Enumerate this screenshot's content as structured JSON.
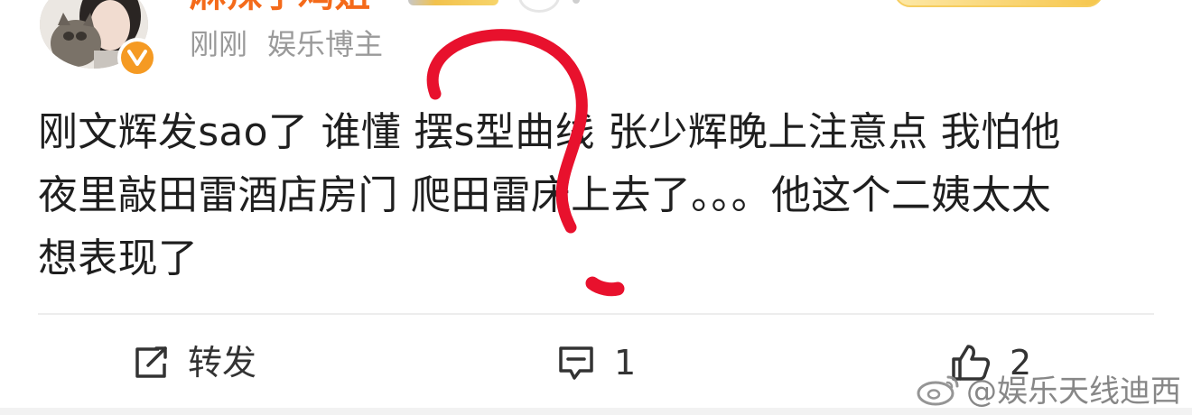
{
  "post": {
    "author": "麻辣子鸡姐",
    "time": "刚刚",
    "tag": "娱乐博主",
    "verified_color": "#f59a23",
    "text_lines": [
      "刚文辉发sao了 谁懂 摆s型曲线 张少辉晚上注意点 我怕他",
      "夜里敲田雷酒店房门 爬田雷床上去了。。。他这个二姨太太",
      "想表现了"
    ]
  },
  "actions": {
    "repost_label": "转发",
    "comment_count": "1",
    "like_count": "2"
  },
  "watermark": {
    "text": "@娱乐天线迪西"
  },
  "colors": {
    "accent": "#f46a1a",
    "scribble": "#e8112d",
    "text": "#1f1f1f",
    "meta": "#9a9a9a"
  },
  "icons": {
    "repost": "repost-icon",
    "comment": "comment-icon",
    "like": "thumbs-up-icon",
    "weibo": "weibo-logo-icon",
    "verified": "verified-v-icon"
  }
}
